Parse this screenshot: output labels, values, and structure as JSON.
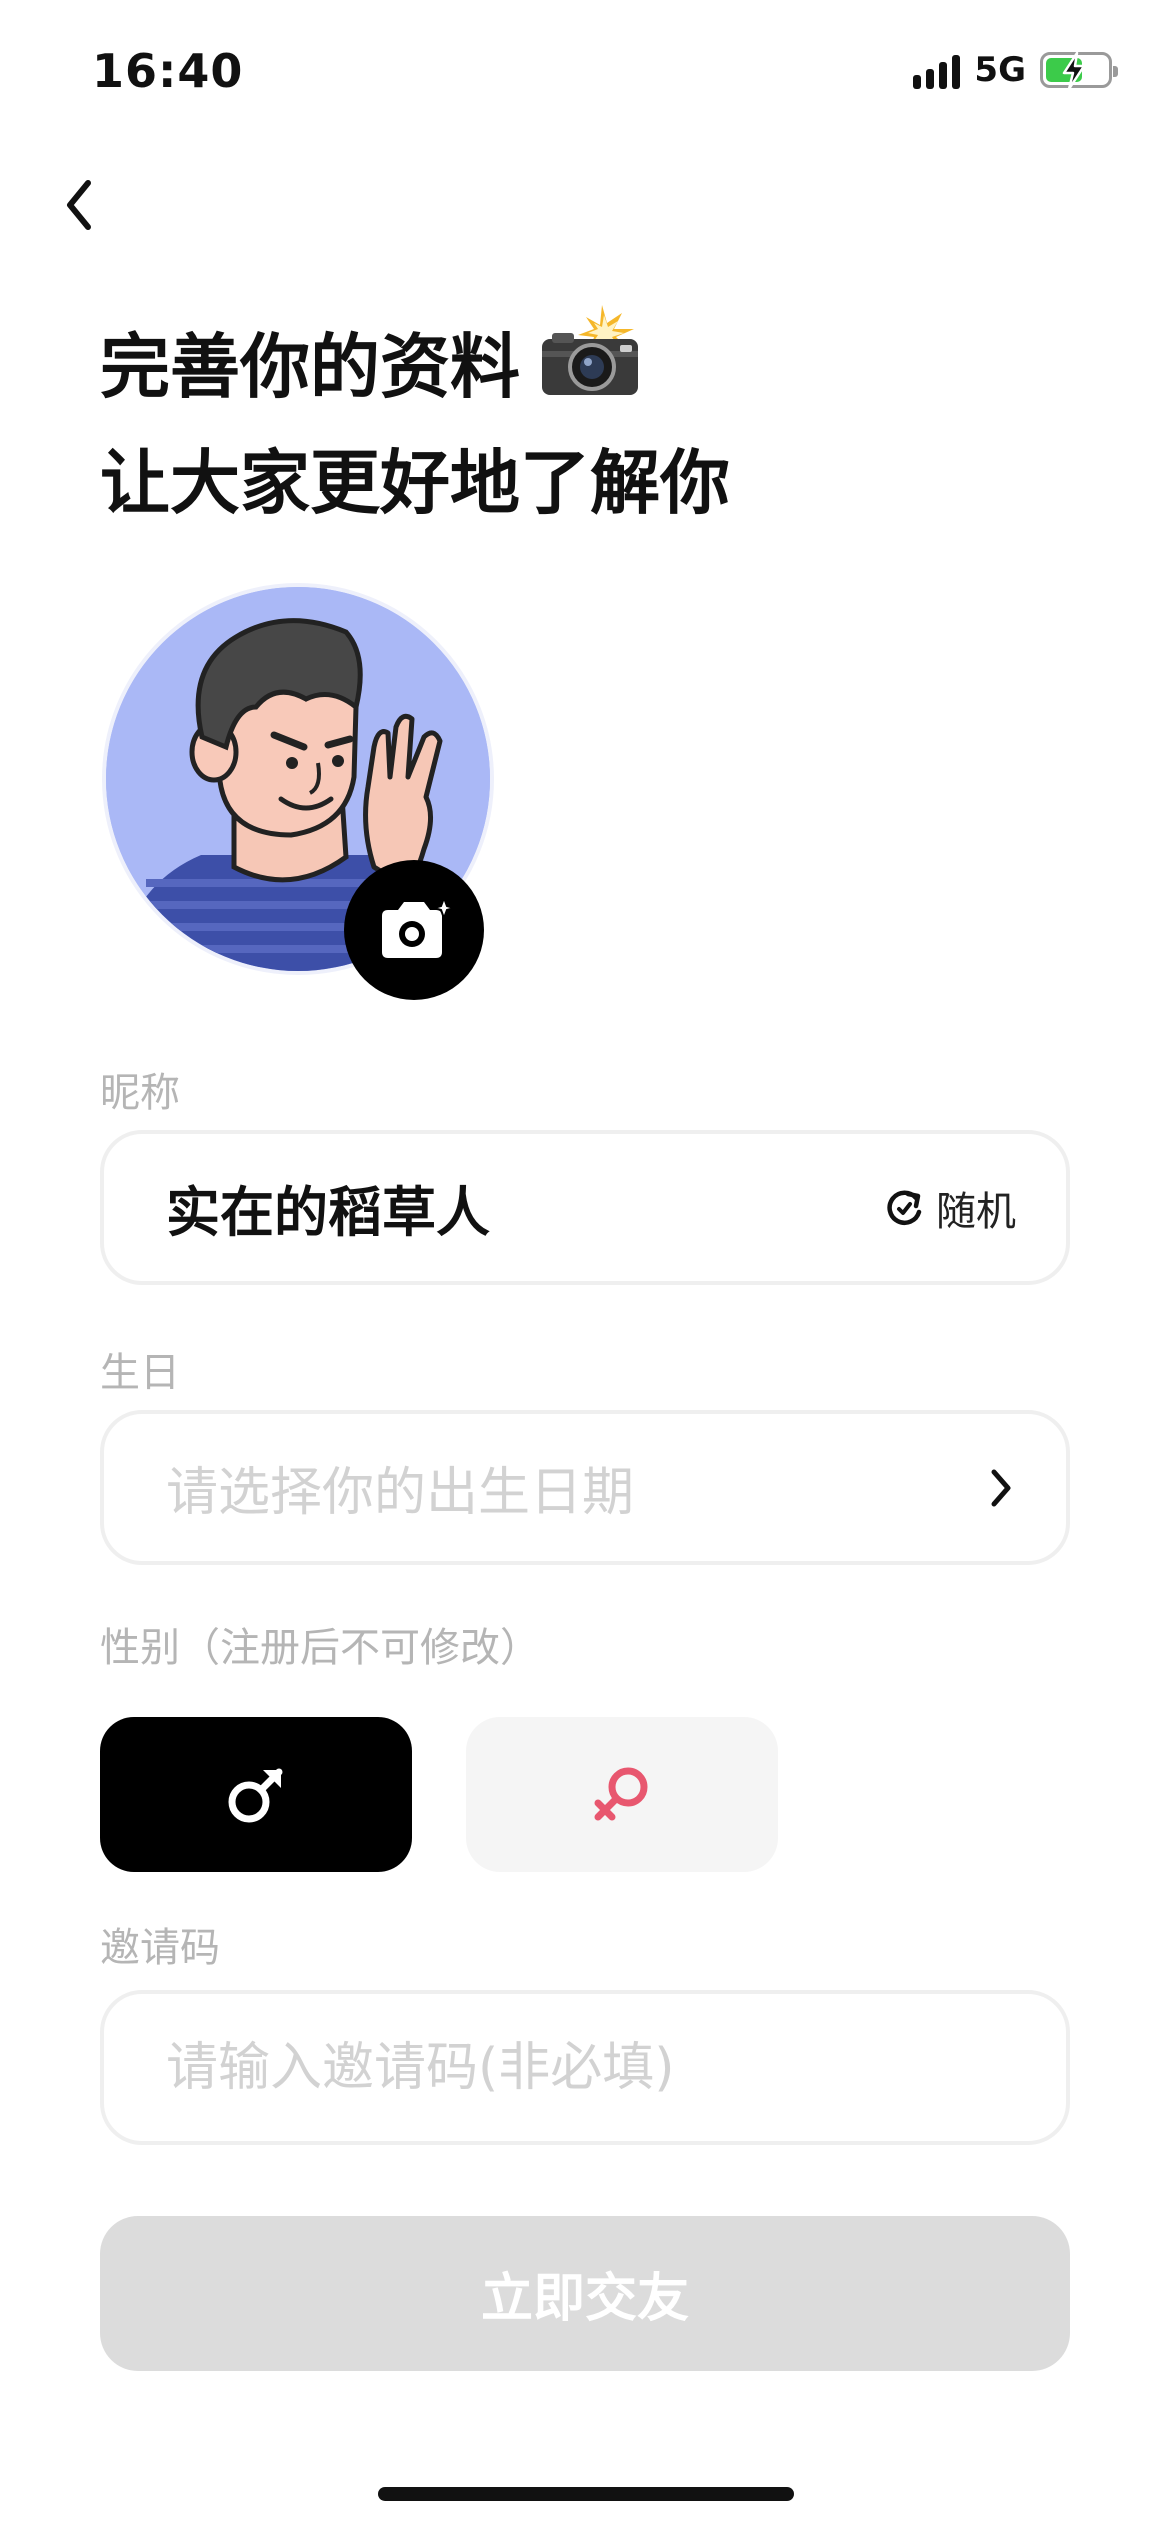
{
  "status_bar": {
    "time": "16:40",
    "network": "5G"
  },
  "title": {
    "line1": "完善你的资料",
    "line2": "让大家更好地了解你"
  },
  "nickname": {
    "label": "昵称",
    "value": "实在的稻草人",
    "random_label": "随机"
  },
  "birthday": {
    "label": "生日",
    "placeholder": "请选择你的出生日期"
  },
  "gender": {
    "label": "性别（注册后不可修改）",
    "selected": "male"
  },
  "invite": {
    "label": "邀请码",
    "placeholder": "请输入邀请码(非必填)"
  },
  "submit": {
    "label": "立即交友"
  },
  "colors": {
    "primary": "#000000",
    "disabled_button": "#dcdcdc",
    "female_accent": "#e8576f",
    "avatar_bg": "#aab8f6",
    "placeholder": "#d2d2d2",
    "label": "#b5b5b5"
  },
  "icons": [
    "back-chevron-icon",
    "camera-flash-emoji",
    "camera-sparkle-icon",
    "refresh-icon",
    "chevron-right-icon",
    "male-symbol-icon",
    "female-symbol-icon"
  ]
}
